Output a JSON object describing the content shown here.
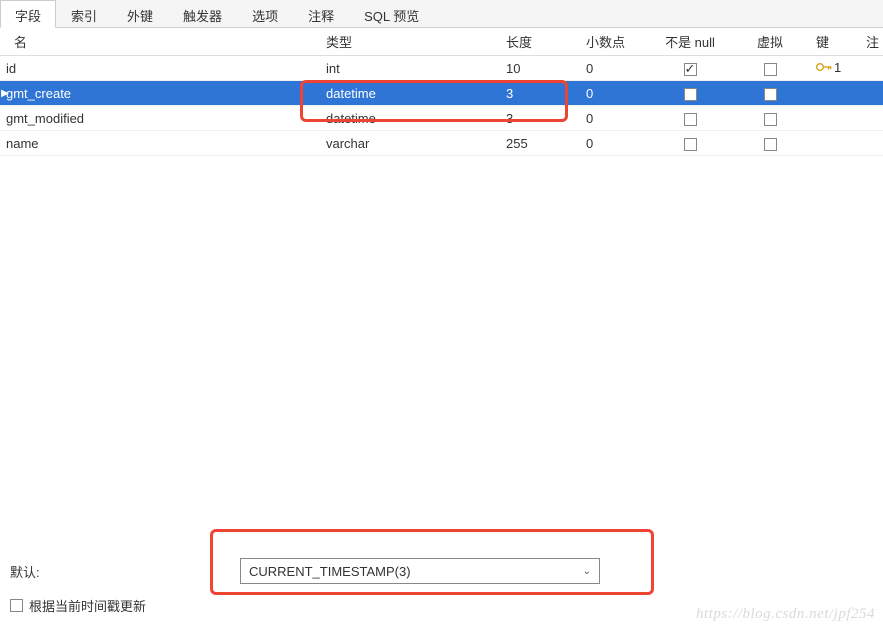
{
  "tabs": {
    "items": [
      {
        "label": "字段",
        "active": true
      },
      {
        "label": "索引",
        "active": false
      },
      {
        "label": "外键",
        "active": false
      },
      {
        "label": "触发器",
        "active": false
      },
      {
        "label": "选项",
        "active": false
      },
      {
        "label": "注释",
        "active": false
      },
      {
        "label": "SQL 预览",
        "active": false
      }
    ]
  },
  "columns": {
    "name": "名",
    "type": "类型",
    "length": "长度",
    "decimal": "小数点",
    "notnull": "不是 null",
    "virtual": "虚拟",
    "key": "键",
    "extra": "注"
  },
  "rows": [
    {
      "name": "id",
      "type": "int",
      "length": "10",
      "decimal": "0",
      "notnull": true,
      "virtual": false,
      "key": "1",
      "selected": false
    },
    {
      "name": "gmt_create",
      "type": "datetime",
      "length": "3",
      "decimal": "0",
      "notnull": false,
      "virtual": false,
      "key": "",
      "selected": true
    },
    {
      "name": "gmt_modified",
      "type": "datetime",
      "length": "3",
      "decimal": "0",
      "notnull": false,
      "virtual": false,
      "key": "",
      "selected": false
    },
    {
      "name": "name",
      "type": "varchar",
      "length": "255",
      "decimal": "0",
      "notnull": false,
      "virtual": false,
      "key": "",
      "selected": false
    }
  ],
  "bottom": {
    "default_label": "默认:",
    "default_value": "CURRENT_TIMESTAMP(3)",
    "update_on_ts_label": "根据当前时间戳更新",
    "update_on_ts_checked": false
  },
  "watermark": "https://blog.csdn.net/jpf254"
}
